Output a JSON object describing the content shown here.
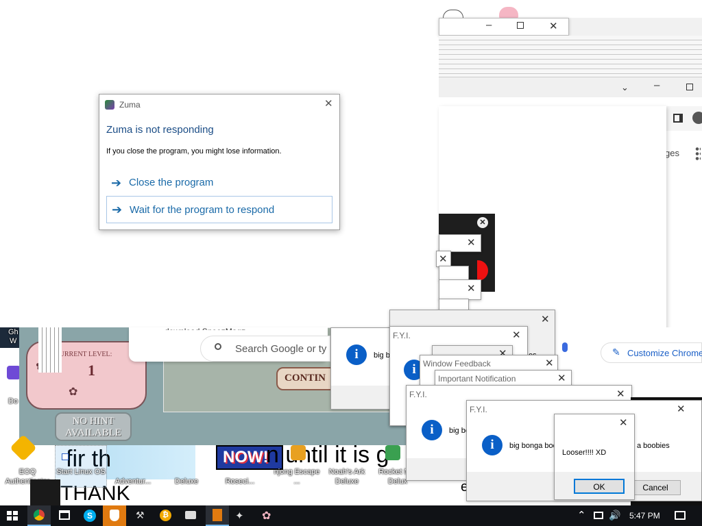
{
  "zuma_dialog": {
    "app_name": "Zuma",
    "heading": "Zuma is not responding",
    "message": "If you close the program, you might lose information.",
    "close_option": "Close the program",
    "wait_option": "Wait for the program to respond"
  },
  "chrome": {
    "search_placeholder": "Search Google or ty",
    "partial_ges": "ges",
    "customize_label": "Customize Chrome",
    "partial_download": "download SnoozMagz"
  },
  "game": {
    "level_label": "CURRENT LEVEL:",
    "level_value": "1",
    "hint_line1": "NO HINT",
    "hint_line2": "AVAILABLE",
    "continue_label": "CONTIN",
    "now_banner": "NOW!"
  },
  "popups": {
    "fyi_title": "F.Y.I.",
    "window_feedback_title": "Window Feedback",
    "important_title": "Important Notification",
    "big_partial": "big b",
    "big_bonga_partial": "big bonga b",
    "big_bonga_text": "big bonga boobies",
    "big_bonga_right": "a boobies",
    "partial_es": "es",
    "looser_text": "Looser!!!! XD",
    "ok_label": "OK",
    "cancel_label": "Cancel"
  },
  "desktop": {
    "background_text": "n until it is g",
    "thank_text": "THANK",
    "partial_e": "e",
    "partial_fir": "fir th",
    "partial_gh": "Gh",
    "partial_w": "W",
    "partial_do": "Do",
    "icons": [
      {
        "label": "EOQ Authenticator"
      },
      {
        "label": "Start Linux OS"
      },
      {
        "label": "Adventur..."
      },
      {
        "label": "Deluxe"
      },
      {
        "label": "Roseci..."
      },
      {
        "label": "njong Escape ..."
      },
      {
        "label": "Noah's Ark Deluxe"
      },
      {
        "label": "Rocket M... Delux"
      }
    ]
  },
  "taskbar": {
    "time": "5:47 PM",
    "apps": [
      "windows-start",
      "chrome",
      "task-view",
      "skype",
      "shield",
      "tool",
      "bitcoin",
      "printer",
      "game",
      "bird",
      "flower"
    ]
  },
  "colors": {
    "taskbar": "#101216",
    "link_blue": "#1a6aa8",
    "heading_blue": "#1b4d86",
    "info_blue": "#0a5fc7",
    "game_pink": "#f2c8cc",
    "game_teal": "#8aa5a8"
  }
}
